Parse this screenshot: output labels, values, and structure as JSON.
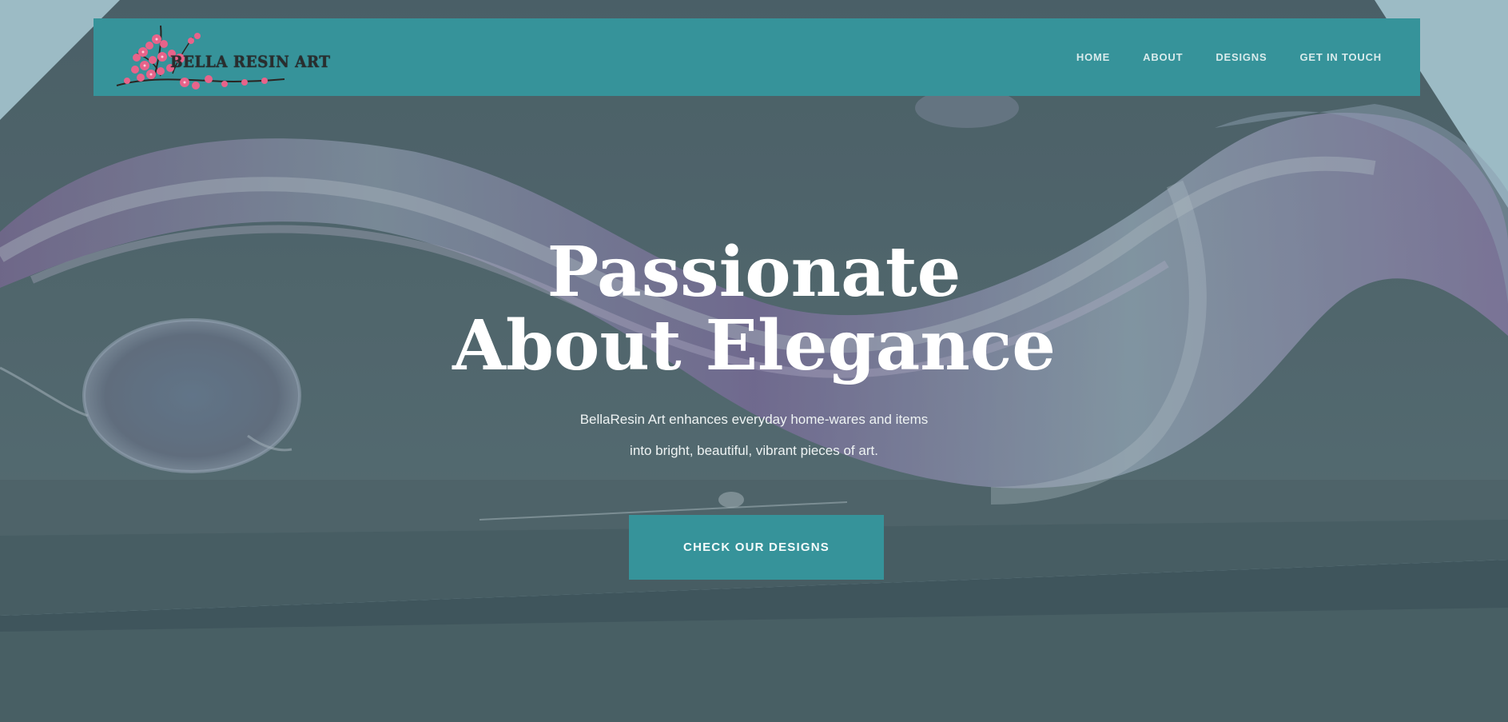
{
  "brand": {
    "logo_text": "BELLA RESIN ART"
  },
  "nav": {
    "items": [
      {
        "label": "HOME"
      },
      {
        "label": "ABOUT"
      },
      {
        "label": "DESIGNS"
      },
      {
        "label": "GET IN TOUCH"
      }
    ]
  },
  "hero": {
    "headline_line1": "Passionate",
    "headline_line2": "About Elegance",
    "subtext_line1": "BellaResin Art enhances everyday home-wares and items",
    "subtext_line2": "into bright, beautiful, vibrant pieces of art.",
    "cta_label": "CHECK OUR DESIGNS"
  },
  "colors": {
    "accent": "#36939a",
    "overlay": "#4c626a",
    "text_light": "#ffffff"
  }
}
